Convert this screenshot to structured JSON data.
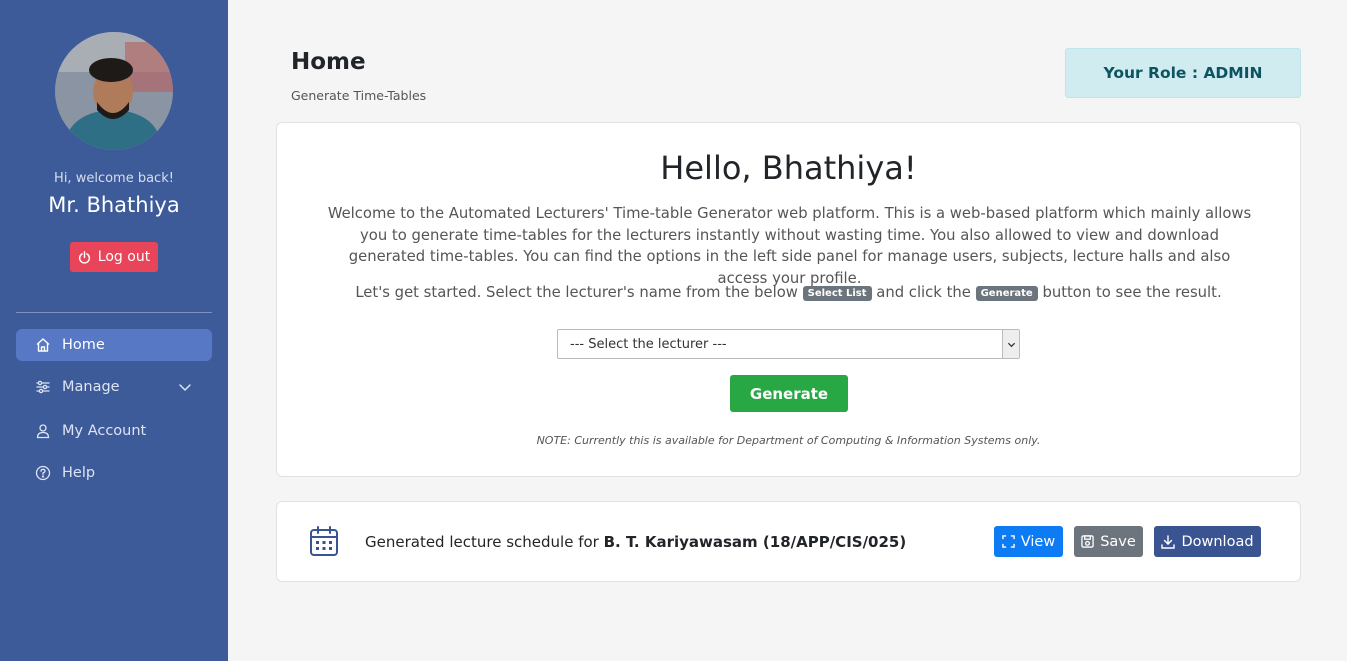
{
  "sidebar": {
    "welcome": "Hi, welcome back!",
    "username": "Mr. Bhathiya",
    "logout_label": "Log out",
    "nav": [
      {
        "label": "Home",
        "icon": "home-icon",
        "active": true
      },
      {
        "label": "Manage",
        "icon": "sliders-icon",
        "has_children": true
      },
      {
        "label": "My Account",
        "icon": "user-icon"
      },
      {
        "label": "Help",
        "icon": "help-icon"
      }
    ]
  },
  "header": {
    "title": "Home",
    "subtitle": "Generate Time-Tables",
    "role": "Your Role : ADMIN"
  },
  "main": {
    "greeting": "Hello, Bhathiya!",
    "intro": "Welcome to the Automated Lecturers' Time-table Generator web platform. This is a web-based platform which mainly allows you to generate time-tables for the lecturers instantly without wasting time. You also allowed to view and download generated time-tables. You can find the options in the left side panel for manage users, subjects, lecture halls and also access your profile.",
    "start_prefix": "Let's get started. Select the lecturer's name from the below",
    "badge_select": "Select List",
    "start_middle": "and click the",
    "badge_generate": "Generate",
    "start_suffix": "button to see the result.",
    "select_value": "--- Select the lecturer ---",
    "generate_label": "Generate",
    "note": "NOTE: Currently this is available for Department of Computing & Information Systems only."
  },
  "schedule": {
    "prefix": "Generated lecture schedule for",
    "lecturer": "B. T. Kariyawasam (18/APP/CIS/025)",
    "view_label": "View",
    "save_label": "Save",
    "download_label": "Download"
  },
  "colors": {
    "sidebar": "#3d5a99",
    "active_nav": "#5778c4",
    "logout": "#e8445a",
    "generate": "#28a745",
    "view": "#0d7bf4",
    "save": "#6c757d",
    "download": "#3a5391",
    "role_bg": "#d1ecf1"
  }
}
